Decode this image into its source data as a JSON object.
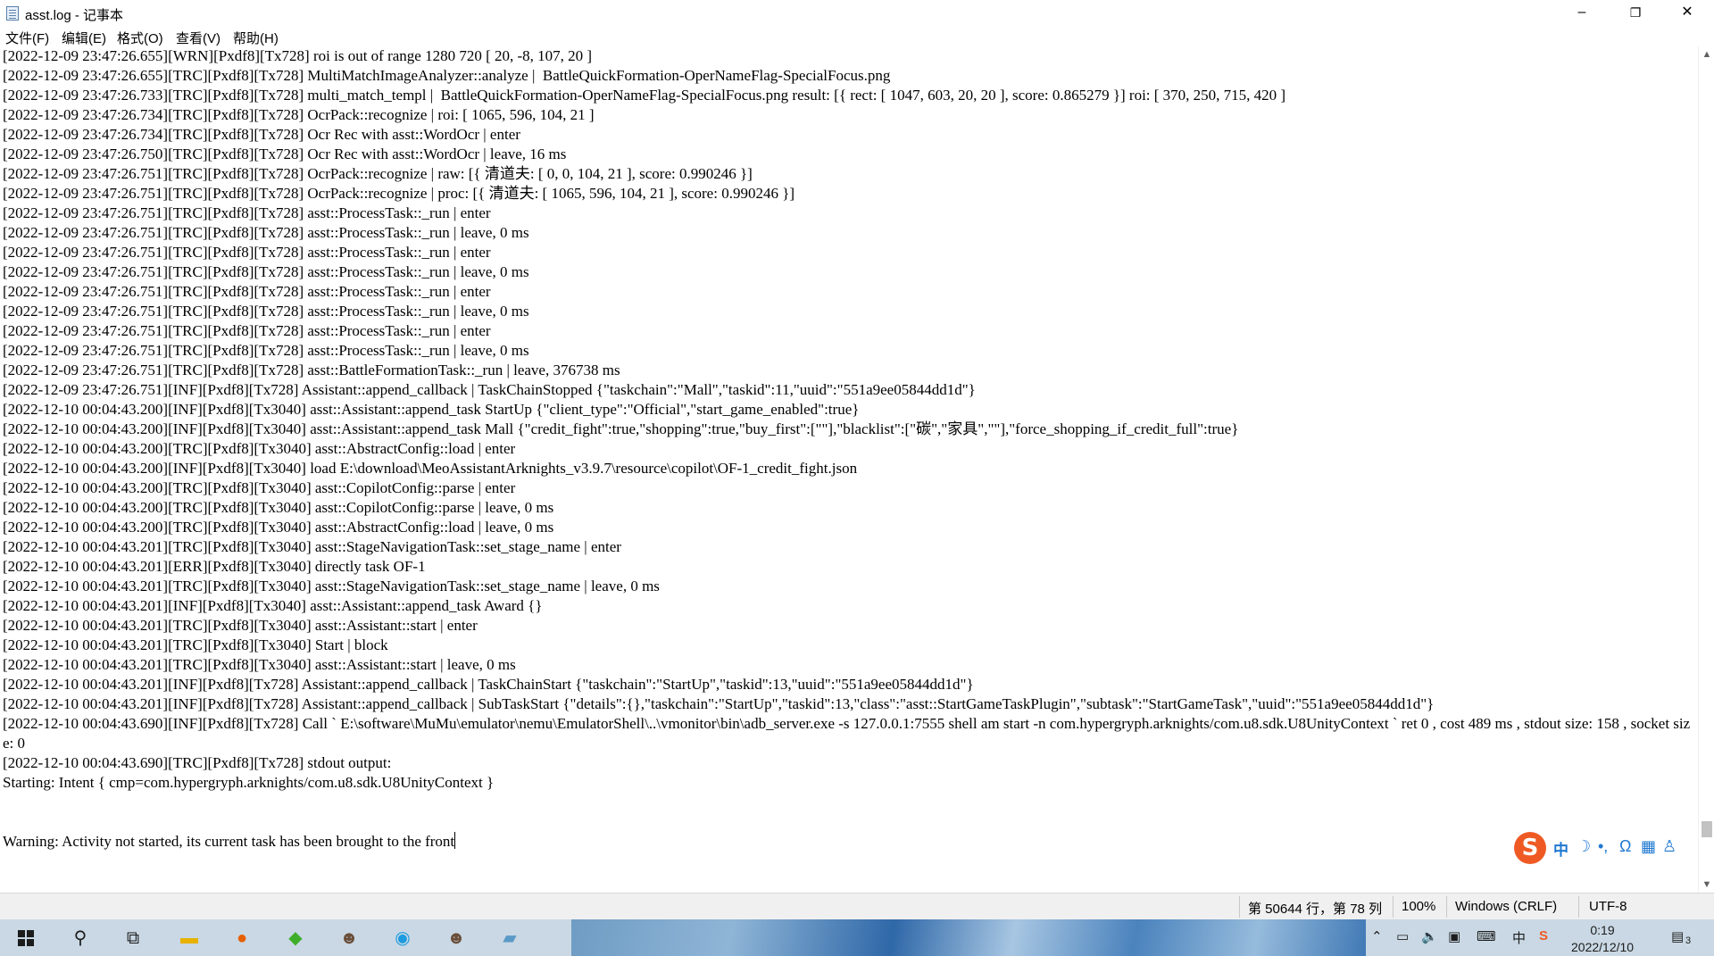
{
  "window": {
    "title": "asst.log - 记事本",
    "minimize_glyph": "–",
    "maximize_glyph": "❐",
    "close_glyph": "✕"
  },
  "menu": [
    "文件(F)",
    "编辑(E)",
    "格式(O)",
    "查看(V)",
    "帮助(H)"
  ],
  "log_lines": [
    "[2022-12-09 23:47:26.655][WRN][Pxdf8][Tx728] roi is out of range 1280 720 [ 20, -8, 107, 20 ]",
    "[2022-12-09 23:47:26.655][TRC][Pxdf8][Tx728] MultiMatchImageAnalyzer::analyze |  BattleQuickFormation-OperNameFlag-SpecialFocus.png",
    "[2022-12-09 23:47:26.733][TRC][Pxdf8][Tx728] multi_match_templ |  BattleQuickFormation-OperNameFlag-SpecialFocus.png result: [{ rect: [ 1047, 603, 20, 20 ], score: 0.865279 }] roi: [ 370, 250, 715, 420 ]",
    "[2022-12-09 23:47:26.734][TRC][Pxdf8][Tx728] OcrPack::recognize | roi: [ 1065, 596, 104, 21 ]",
    "[2022-12-09 23:47:26.734][TRC][Pxdf8][Tx728] Ocr Rec with asst::WordOcr | enter",
    "[2022-12-09 23:47:26.750][TRC][Pxdf8][Tx728] Ocr Rec with asst::WordOcr | leave, 16 ms",
    "[2022-12-09 23:47:26.751][TRC][Pxdf8][Tx728] OcrPack::recognize | raw: [{ 清道夫: [ 0, 0, 104, 21 ], score: 0.990246 }]",
    "[2022-12-09 23:47:26.751][TRC][Pxdf8][Tx728] OcrPack::recognize | proc: [{ 清道夫: [ 1065, 596, 104, 21 ], score: 0.990246 }]",
    "[2022-12-09 23:47:26.751][TRC][Pxdf8][Tx728] asst::ProcessTask::_run | enter",
    "[2022-12-09 23:47:26.751][TRC][Pxdf8][Tx728] asst::ProcessTask::_run | leave, 0 ms",
    "[2022-12-09 23:47:26.751][TRC][Pxdf8][Tx728] asst::ProcessTask::_run | enter",
    "[2022-12-09 23:47:26.751][TRC][Pxdf8][Tx728] asst::ProcessTask::_run | leave, 0 ms",
    "[2022-12-09 23:47:26.751][TRC][Pxdf8][Tx728] asst::ProcessTask::_run | enter",
    "[2022-12-09 23:47:26.751][TRC][Pxdf8][Tx728] asst::ProcessTask::_run | leave, 0 ms",
    "[2022-12-09 23:47:26.751][TRC][Pxdf8][Tx728] asst::ProcessTask::_run | enter",
    "[2022-12-09 23:47:26.751][TRC][Pxdf8][Tx728] asst::ProcessTask::_run | leave, 0 ms",
    "[2022-12-09 23:47:26.751][TRC][Pxdf8][Tx728] asst::BattleFormationTask::_run | leave, 376738 ms",
    "[2022-12-09 23:47:26.751][INF][Pxdf8][Tx728] Assistant::append_callback | TaskChainStopped {\"taskchain\":\"Mall\",\"taskid\":11,\"uuid\":\"551a9ee05844dd1d\"}",
    "[2022-12-10 00:04:43.200][INF][Pxdf8][Tx3040] asst::Assistant::append_task StartUp {\"client_type\":\"Official\",\"start_game_enabled\":true}",
    "[2022-12-10 00:04:43.200][INF][Pxdf8][Tx3040] asst::Assistant::append_task Mall {\"credit_fight\":true,\"shopping\":true,\"buy_first\":[\"\"],\"blacklist\":[\"碳\",\"家具\",\"\"],\"force_shopping_if_credit_full\":true}",
    "[2022-12-10 00:04:43.200][TRC][Pxdf8][Tx3040] asst::AbstractConfig::load | enter",
    "[2022-12-10 00:04:43.200][INF][Pxdf8][Tx3040] load E:\\download\\MeoAssistantArknights_v3.9.7\\resource\\copilot\\OF-1_credit_fight.json",
    "[2022-12-10 00:04:43.200][TRC][Pxdf8][Tx3040] asst::CopilotConfig::parse | enter",
    "[2022-12-10 00:04:43.200][TRC][Pxdf8][Tx3040] asst::CopilotConfig::parse | leave, 0 ms",
    "[2022-12-10 00:04:43.200][TRC][Pxdf8][Tx3040] asst::AbstractConfig::load | leave, 0 ms",
    "[2022-12-10 00:04:43.201][TRC][Pxdf8][Tx3040] asst::StageNavigationTask::set_stage_name | enter",
    "[2022-12-10 00:04:43.201][ERR][Pxdf8][Tx3040] directly task OF-1",
    "[2022-12-10 00:04:43.201][TRC][Pxdf8][Tx3040] asst::StageNavigationTask::set_stage_name | leave, 0 ms",
    "[2022-12-10 00:04:43.201][INF][Pxdf8][Tx3040] asst::Assistant::append_task Award {}",
    "[2022-12-10 00:04:43.201][TRC][Pxdf8][Tx3040] asst::Assistant::start | enter",
    "[2022-12-10 00:04:43.201][TRC][Pxdf8][Tx3040] Start | block",
    "[2022-12-10 00:04:43.201][TRC][Pxdf8][Tx3040] asst::Assistant::start | leave, 0 ms",
    "[2022-12-10 00:04:43.201][INF][Pxdf8][Tx728] Assistant::append_callback | TaskChainStart {\"taskchain\":\"StartUp\",\"taskid\":13,\"uuid\":\"551a9ee05844dd1d\"}",
    "[2022-12-10 00:04:43.201][INF][Pxdf8][Tx728] Assistant::append_callback | SubTaskStart {\"details\":{},\"taskchain\":\"StartUp\",\"taskid\":13,\"class\":\"asst::StartGameTaskPlugin\",\"subtask\":\"StartGameTask\",\"uuid\":\"551a9ee05844dd1d\"}",
    "[2022-12-10 00:04:43.690][INF][Pxdf8][Tx728] Call ` E:\\software\\MuMu\\emulator\\nemu\\EmulatorShell\\..\\vmonitor\\bin\\adb_server.exe -s 127.0.0.1:7555 shell am start -n com.hypergryph.arknights/com.u8.sdk.U8UnityContext ` ret 0 , cost 489 ms , stdout size: 158 , socket size: 0",
    "[2022-12-10 00:04:43.690][TRC][Pxdf8][Tx728] stdout output:",
    "Starting: Intent { cmp=com.hypergryph.arknights/com.u8.sdk.U8UnityContext }",
    "",
    "",
    "Warning: Activity not started, its current task has been brought to the front"
  ],
  "status": {
    "position": "第 50644 行，第 78 列",
    "zoom": "100%",
    "line_ending": "Windows (CRLF)",
    "encoding": "UTF-8"
  },
  "ime": {
    "logo": "S",
    "mode": "中",
    "moon": "☽",
    "punct": "•,",
    "headset": "Ω",
    "keyboard": "▦",
    "user": "♙"
  },
  "taskbar": {
    "clock_time": "0:19",
    "clock_date": "2022/12/10",
    "tray_lang": "中",
    "notification_count": "3"
  }
}
